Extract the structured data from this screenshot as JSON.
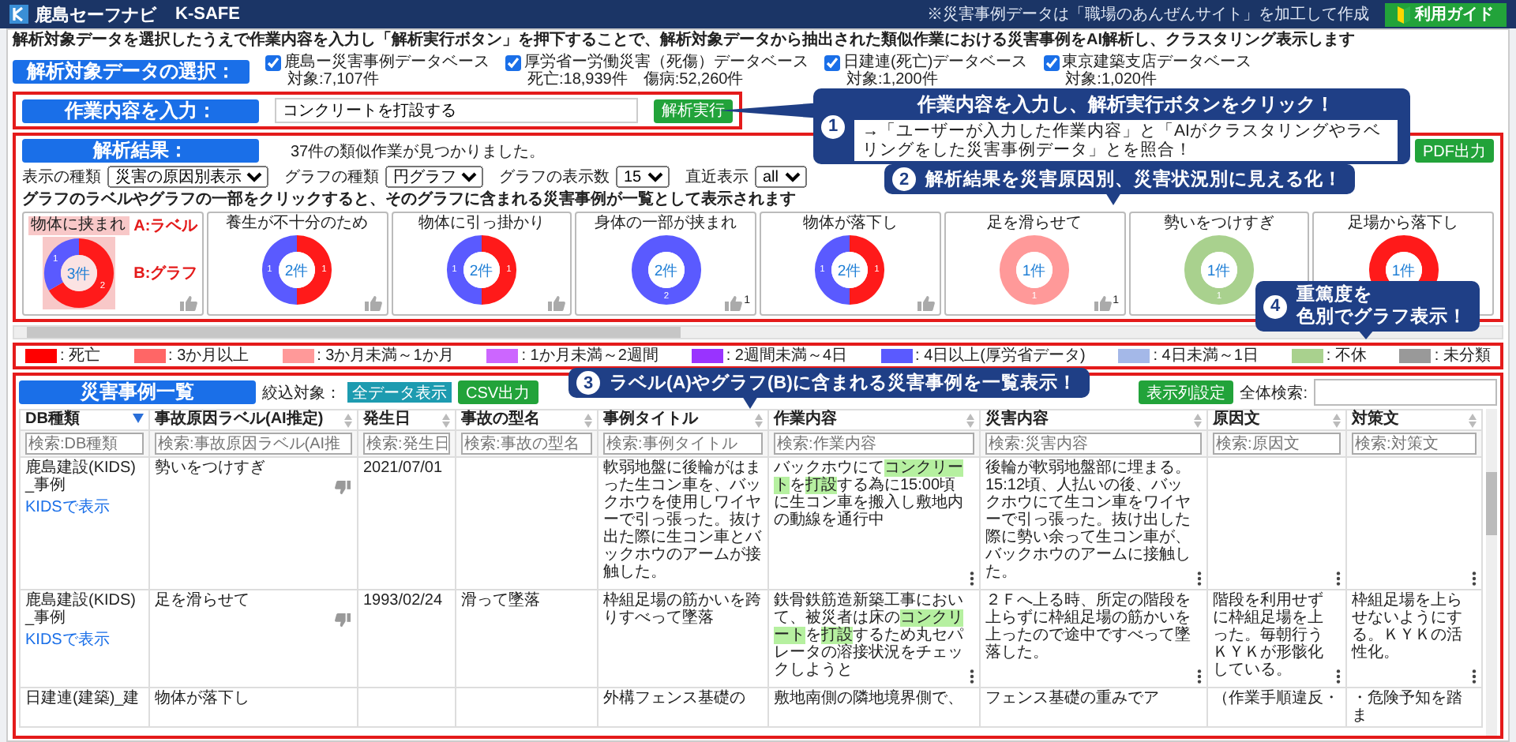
{
  "header": {
    "logo": "鹿島セーフナビ",
    "product": "K-SAFE",
    "guide_button": "利用ガイド"
  },
  "credit": "※災害事例データは「職場のあんぜんサイト」を加工して作成",
  "description": "解析対象データを選択したうえで作業内容を入力し「解析実行ボタン」を押下することで、解析対象データから抽出された類似作業における災害事例をAI解析し、クラスタリング表示します",
  "data_select": {
    "label": "解析対象データの選択：",
    "sources": [
      {
        "name": "鹿島ー災害事例データベース",
        "count": "対象:7,107件",
        "checked": true
      },
      {
        "name": "厚労省ー労働災害（死傷）データベース",
        "count": "死亡:18,939件　傷病:52,260件",
        "checked": true
      },
      {
        "name": "日建連(死亡)データベース",
        "count": "対象:1,200件",
        "checked": true
      },
      {
        "name": "東京建築支店データベース",
        "count": "対象:1,020件",
        "checked": true
      }
    ]
  },
  "task_input": {
    "label": "作業内容を入力：",
    "value": "コンクリートを打設する",
    "button": "解析実行"
  },
  "results": {
    "label": "解析結果：",
    "summary": "37件の類似作業が見つかりました。",
    "pdf_button": "PDF出力",
    "filters": [
      {
        "label": "表示の種類",
        "value": "災害の原因別表示"
      },
      {
        "label": "グラフの種類",
        "value": "円グラフ"
      },
      {
        "label": "グラフの表示数",
        "value": "15"
      },
      {
        "label": "直近表示",
        "value": "all"
      }
    ],
    "hint": "グラフのラベルやグラフの一部をクリックすると、そのグラフに含まれる災害事例が一覧として表示されます",
    "markers": {
      "label": "A:ラベル",
      "graph": "B:グラフ"
    },
    "cards": [
      {
        "title": "物体に挟まれ",
        "selected": true,
        "total": "3件",
        "thumb": true,
        "chart_data": {
          "type": "donut",
          "values": [
            2,
            1
          ],
          "colors": [
            "#ff1a1a",
            "#5a5aff"
          ],
          "data_labels": true
        }
      },
      {
        "title": "養生が不十分のため",
        "selected": false,
        "total": "2件",
        "thumb": true,
        "chart_data": {
          "type": "donut",
          "values": [
            1,
            1
          ],
          "colors": [
            "#ff1a1a",
            "#5a5aff"
          ],
          "data_labels": true
        }
      },
      {
        "title": "物体に引っ掛かり",
        "selected": false,
        "total": "2件",
        "thumb": true,
        "chart_data": {
          "type": "donut",
          "values": [
            1,
            1
          ],
          "colors": [
            "#ff1a1a",
            "#5a5aff"
          ],
          "data_labels": true
        }
      },
      {
        "title": "身体の一部が挟まれ",
        "selected": false,
        "total": "2件",
        "thumb": true,
        "likes": "1",
        "chart_data": {
          "type": "donut",
          "values": [
            2
          ],
          "colors": [
            "#5a5aff"
          ],
          "data_labels": true
        }
      },
      {
        "title": "物体が落下し",
        "selected": false,
        "total": "2件",
        "thumb": true,
        "chart_data": {
          "type": "donut",
          "values": [
            1,
            1
          ],
          "colors": [
            "#ff1a1a",
            "#5a5aff"
          ],
          "data_labels": true
        }
      },
      {
        "title": "足を滑らせて",
        "selected": false,
        "total": "1件",
        "thumb": true,
        "likes": "1",
        "chart_data": {
          "type": "donut",
          "values": [
            1
          ],
          "colors": [
            "#ff9999"
          ],
          "data_labels": true
        }
      },
      {
        "title": "勢いをつけすぎ",
        "selected": false,
        "total": "1件",
        "thumb": false,
        "chart_data": {
          "type": "donut",
          "values": [
            1
          ],
          "colors": [
            "#a9d18e"
          ],
          "data_labels": true
        }
      },
      {
        "title": "足場から落下し",
        "selected": false,
        "total": "1件",
        "thumb": false,
        "chart_data": {
          "type": "donut",
          "values": [
            1
          ],
          "colors": [
            "#ff1a1a"
          ],
          "data_labels": false
        }
      }
    ]
  },
  "legend": [
    {
      "label": ": 死亡",
      "color": "#ff0000"
    },
    {
      "label": ": 3か月以上",
      "color": "#ff6666"
    },
    {
      "label": ": 3か月未満～1か月",
      "color": "#ff9999"
    },
    {
      "label": ": 1か月未満～2週間",
      "color": "#cc66ff"
    },
    {
      "label": ": 2週間未満～4日",
      "color": "#9933ff"
    },
    {
      "label": ": 4日以上(厚労省データ)",
      "color": "#5a5aff"
    },
    {
      "label": ": 4日未満～1日",
      "color": "#a4b8e8"
    },
    {
      "label": ": 不休",
      "color": "#a9d18e"
    },
    {
      "label": ": 未分類",
      "color": "#999999"
    }
  ],
  "cases": {
    "label": "災害事例一覧",
    "filter_label": "絞込対象：",
    "filter_tag": "全データ表示",
    "csv_button": "CSV出力",
    "columns_button": "表示列設定",
    "search_label": "全体検索:",
    "columns": [
      {
        "title": "DB種類",
        "sorted": true,
        "placeholder": "検索:DB種類"
      },
      {
        "title": "事故原因ラベル(AI推定)",
        "sorted": false,
        "placeholder": "検索:事故原因ラベル(AI推"
      },
      {
        "title": "発生日",
        "sorted": false,
        "placeholder": "検索:発生日"
      },
      {
        "title": "事故の型名",
        "sorted": false,
        "placeholder": "検索:事故の型名"
      },
      {
        "title": "事例タイトル",
        "sorted": false,
        "placeholder": "検索:事例タイトル"
      },
      {
        "title": "作業内容",
        "sorted": false,
        "placeholder": "検索:作業内容"
      },
      {
        "title": "災害内容",
        "sorted": false,
        "placeholder": "検索:災害内容"
      },
      {
        "title": "原因文",
        "sorted": false,
        "placeholder": "検索:原因文"
      },
      {
        "title": "対策文",
        "sorted": false,
        "placeholder": "検索:対策文"
      }
    ],
    "rows": [
      {
        "link": "KIDSで表示",
        "cells": [
          "鹿島建設(KIDS)_事例",
          "勢いをつけすぎ",
          "2021/07/01",
          null,
          "軟弱地盤に後輪がはまった生コン車を、バックホウを使用しワイヤーで引っ張った。抜け出た際に生コン車とバックホウのアームが接触した。",
          "バックホウにて**コンクリート**を**打設**する為に15:00頃に生コン車を搬入し敷地内の動線を通行中",
          "後輪が軟弱地盤部に埋まる。15:12頃、人払いの後、バックホウにて生コン車をワイヤーで引っ張った。抜け出した際に勢い余って生コン車が、バックホウのアームに接触した。",
          null,
          null
        ]
      },
      {
        "link": "KIDSで表示",
        "cells": [
          "鹿島建設(KIDS)_事例",
          "足を滑らせて",
          "1993/02/24",
          "滑って墜落",
          "枠組足場の筋かいを跨りすべって墜落",
          "鉄骨鉄筋造新築工事において、被災者は床の**コンクリート**を**打設**するため丸セパレータの溶接状況をチェックしようと",
          "２Ｆへ上る時、所定の階段を上らずに枠組足場の筋かいを上ったので途中ですべって墜落した。",
          "階段を利用せずに枠組足場を上った。毎朝行うＫＹＫが形骸化している。",
          "枠組足場を上らせないようにする。ＫＹＫの活性化。"
        ]
      },
      {
        "cells": [
          "日建連(建築)_建",
          "物体が落下し",
          null,
          null,
          "外構フェンス基礎の",
          "敷地南側の隣地境界側で、",
          "フェンス基礎の重みでア",
          "（作業手順違反・",
          "・危険予知を踏ま"
        ]
      }
    ]
  },
  "callouts": [
    {
      "number": "1",
      "title": "作業内容を入力し、解析実行ボタンをクリック！",
      "body": "→「ユーザーが入力した作業内容」と「AIがクラスタリングやラベリングをした災害事例データ」とを照合！"
    },
    {
      "number": "2",
      "lines": [
        "解析結果を災害原因別、災害状況別に見える化！"
      ]
    },
    {
      "number": "3",
      "lines": [
        "ラベル(A)やグラフ(B)に含まれる災害事例を一覧表示！"
      ]
    },
    {
      "number": "4",
      "lines": [
        "重篤度を",
        "色別でグラフ表示！"
      ]
    }
  ]
}
